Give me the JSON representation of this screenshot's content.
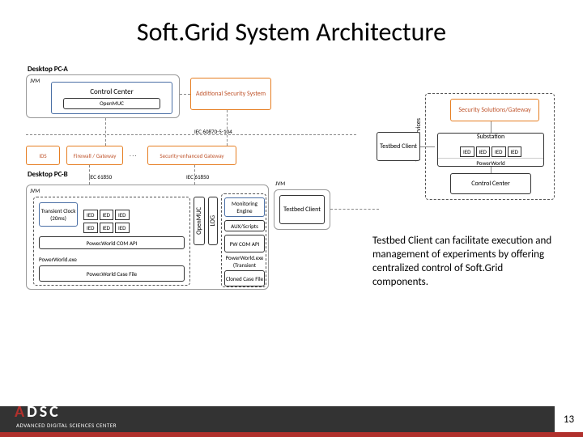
{
  "title": "Soft.Grid System Architecture",
  "labels": {
    "desktopA": "Desktop PC-A",
    "desktopB": "Desktop PC-B",
    "jvm": "JVM",
    "controlCenter1": "Control Center",
    "openmuc": "OpenMUC",
    "addSec": "Additional Security System",
    "iec104": "IEC 60870-5-104",
    "ids": "IDS",
    "firewall": "Firewall / Gateway",
    "dots": ". . .",
    "secGateway": "Security-enhanced Gateway",
    "iec61850a": "IEC 61850",
    "iec61850b": "IEC 61850",
    "transientClock": "Transient Clock (20ms)",
    "ied": "IED",
    "openMucV": "OpenMUC",
    "logV": "LOG",
    "monEngine": "Monitoring Engine",
    "auxScripts": "AUX/Scripts",
    "pwComApi": "PW COM API",
    "pwComApiBar": "Power.World COM API",
    "pwExe": "PowerWorld.exe",
    "pwExeTrans": "PowerWorld.exe (Transient stability)",
    "pwCase": "Power.World Case File",
    "clonedCase": "Cloned Case File",
    "testbedClient": "Testbed Client",
    "testbedServices": "Testbed Services",
    "securitySol": "Security Solutions/Gateway",
    "substation": "Substation",
    "powerWorld": "PowerWorld",
    "controlCenter2": "Control Center"
  },
  "caption": "Testbed Client can facilitate execution and management of experiments by offering centralized control of Soft.Grid components.",
  "pageNumber": "13",
  "footer": {
    "org": "ADSC",
    "orgA": "A",
    "sub": "ADVANCED DIGITAL SCIENCES CENTER"
  }
}
